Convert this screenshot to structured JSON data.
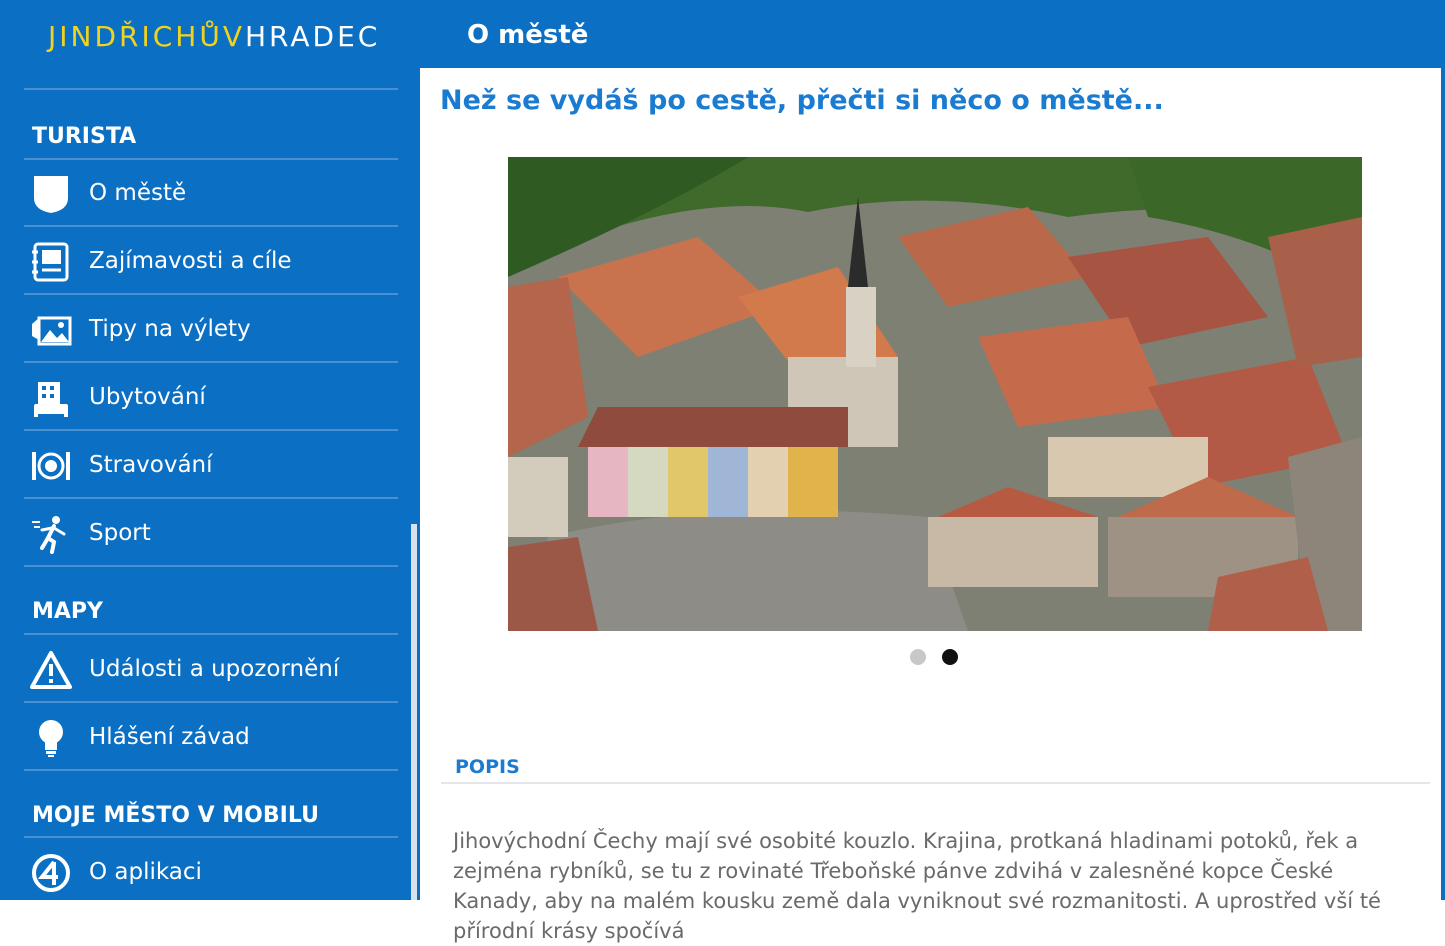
{
  "app": {
    "logo_part1": "JINDŘICHŮV",
    "logo_part2": "HRADEC",
    "page_title": "O městě"
  },
  "sidebar": {
    "sections": [
      {
        "title": "TURISTA"
      },
      {
        "title": "MAPY"
      },
      {
        "title": "MOJE MĚSTO V MOBILU"
      }
    ],
    "items": [
      {
        "label": "O městě",
        "icon": "shield-icon"
      },
      {
        "label": "Zajímavosti a cíle",
        "icon": "guidebook-icon"
      },
      {
        "label": "Tipy na výlety",
        "icon": "landscape-photo-icon"
      },
      {
        "label": "Ubytování",
        "icon": "hotel-icon"
      },
      {
        "label": "Stravování",
        "icon": "plate-cutlery-icon"
      },
      {
        "label": "Sport",
        "icon": "runner-icon"
      },
      {
        "label": "Události a upozornění",
        "icon": "warning-triangle-icon"
      },
      {
        "label": "Hlášení závad",
        "icon": "lightbulb-icon"
      },
      {
        "label": "O aplikaci",
        "icon": "app-info-icon"
      }
    ]
  },
  "main": {
    "heading": "Než se vydáš po cestě, přečti si něco o městě...",
    "carousel": {
      "count": 2,
      "active_index": 1,
      "active_color": "#111111",
      "inactive_color": "#c8c8c8"
    },
    "section_title": "POPIS",
    "description": "Jihovýchodní Čechy mají své osobité kouzlo. Krajina, protkaná hladinami potoků, řek a zejména rybníků, se tu z rovinaté Třeboňské pánve zdvihá v zalesněné kopce České Kanady, aby na malém kousku země dala vyniknout své rozmanitosti. A uprostřed vší té přírodní krásy spočívá"
  },
  "colors": {
    "brand_blue": "#0b6fc3",
    "logo_yellow": "#f2d31c",
    "link_blue": "#1a7bd0"
  }
}
